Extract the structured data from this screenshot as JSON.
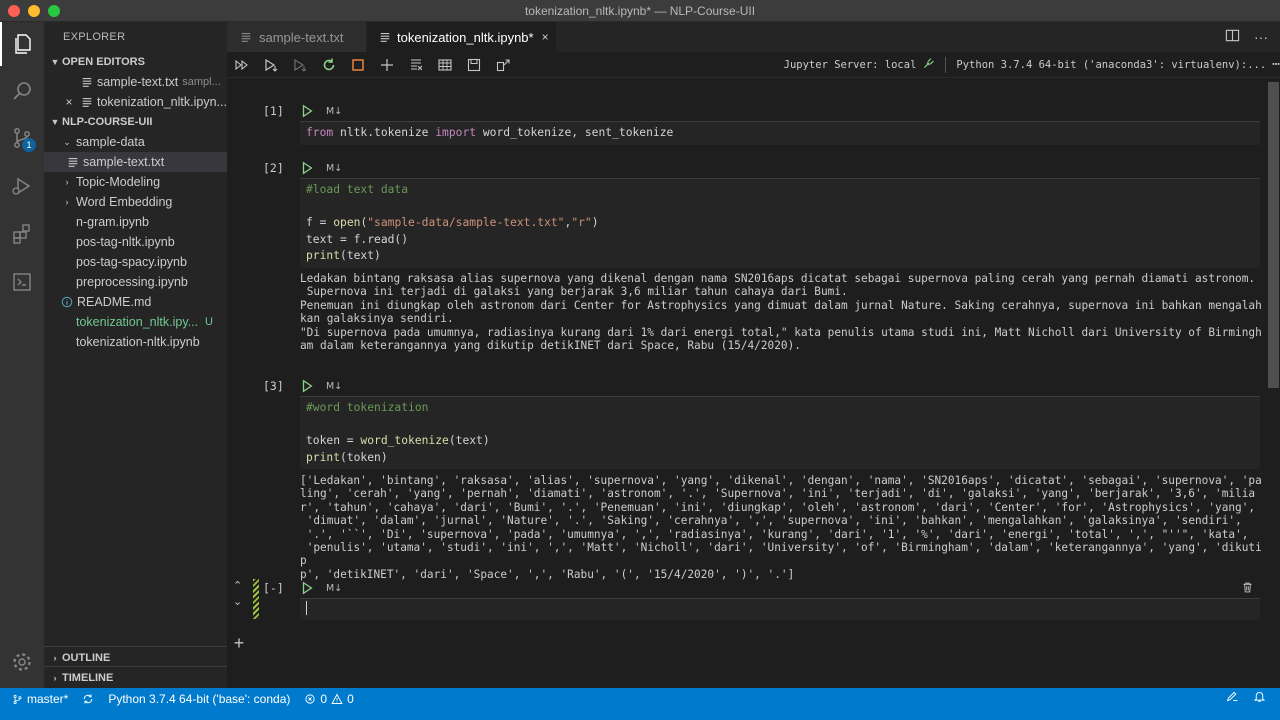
{
  "window": {
    "title": "tokenization_nltk.ipynb* — NLP-Course-UII"
  },
  "activity_bar": {
    "scm_badge": "1"
  },
  "sidebar": {
    "title": "EXPLORER",
    "open_editors": {
      "label": "OPEN EDITORS",
      "items": [
        {
          "name": "sample-text.txt",
          "detail": "sampl..."
        },
        {
          "name": "tokenization_nltk.ipyn..."
        }
      ]
    },
    "workspace": {
      "label": "NLP-COURSE-UII",
      "folder_sample_data": "sample-data",
      "file_sample_text": "sample-text.txt",
      "folder_topic_modeling": "Topic-Modeling",
      "folder_word_embedding": "Word Embedding",
      "file_ngram": "n-gram.ipynb",
      "file_pos_nltk": "pos-tag-nltk.ipynb",
      "file_pos_spacy": "pos-tag-spacy.ipynb",
      "file_preprocessing": "preprocessing.ipynb",
      "file_readme": "README.md",
      "file_tokenization_underscore": "tokenization_nltk.ipy...",
      "file_tokenization_underscore_status": "U",
      "file_tokenization_dash": "tokenization-nltk.ipynb"
    },
    "outline_label": "OUTLINE",
    "timeline_label": "TIMELINE"
  },
  "tabs": [
    {
      "label": "sample-text.txt"
    },
    {
      "label": "tokenization_nltk.ipynb*",
      "close": "×"
    }
  ],
  "tab_more": "···",
  "toolbar": {
    "jupyter_server": "Jupyter Server: local",
    "python_kernel": "Python 3.7.4 64-bit ('anaconda3': virtualenv):..."
  },
  "cells": [
    {
      "exec": "[1]",
      "md": "M↓",
      "code_import_kw_from": "from",
      "code_import_mod": " nltk.tokenize ",
      "code_import_kw_import": "import",
      "code_import_names": " word_tokenize, sent_tokenize"
    },
    {
      "exec": "[2]",
      "md": "M↓",
      "comment": "#load text data",
      "l2a": "f = ",
      "l2fn": "open",
      "l2b": "(",
      "l2s1": "\"sample-data/sample-text.txt\"",
      "l2c": ",",
      "l2s2": "\"r\"",
      "l2d": ")",
      "l3": "text = f.read()",
      "l4fn": "print",
      "l4": "(text)",
      "output": "Ledakan bintang raksasa alias supernova yang dikenal dengan nama SN2016aps dicatat sebagai supernova paling cerah yang pernah diamati astronom.\n Supernova ini terjadi di galaksi yang berjarak 3,6 miliar tahun cahaya dari Bumi.\nPenemuan ini diungkap oleh astronom dari Center for Astrophysics yang dimuat dalam jurnal Nature. Saking cerahnya, supernova ini bahkan mengalah\nkan galaksinya sendiri.\n\"Di supernova pada umumnya, radiasinya kurang dari 1% dari energi total,\" kata penulis utama studi ini, Matt Nicholl dari University of Birmingh\nam dalam keterangannya yang dikutip detikINET dari Space, Rabu (15/4/2020)."
    },
    {
      "exec": "[3]",
      "md": "M↓",
      "comment": "#word tokenization",
      "l2a": "token = ",
      "l2fn": "word_tokenize",
      "l2b": "(text)",
      "l3fn": "print",
      "l3": "(token)",
      "output": "['Ledakan', 'bintang', 'raksasa', 'alias', 'supernova', 'yang', 'dikenal', 'dengan', 'nama', 'SN2016aps', 'dicatat', 'sebagai', 'supernova', 'pa\nling', 'cerah', 'yang', 'pernah', 'diamati', 'astronom', '.', 'Supernova', 'ini', 'terjadi', 'di', 'galaksi', 'yang', 'berjarak', '3,6', 'milia\nr', 'tahun', 'cahaya', 'dari', 'Bumi', '.', 'Penemuan', 'ini', 'diungkap', 'oleh', 'astronom', 'dari', 'Center', 'for', 'Astrophysics', 'yang',\n 'dimuat', 'dalam', 'jurnal', 'Nature', '.', 'Saking', 'cerahnya', ',', 'supernova', 'ini', 'bahkan', 'mengalahkan', 'galaksinya', 'sendiri',\n '.', '``', 'Di', 'supernova', 'pada', 'umumnya', ',', 'radiasinya', 'kurang', 'dari', '1', '%', 'dari', 'energi', 'total', ',', \"''\", 'kata',\n 'penulis', 'utama', 'studi', 'ini', ',', 'Matt', 'Nicholl', 'dari', 'University', 'of', 'Birmingham', 'dalam', 'keterangannya', 'yang', 'dikutip\np', 'detikINET', 'dari', 'Space', ',', 'Rabu', '(', '15/4/2020', ')', '.']"
    },
    {
      "exec": "[-]",
      "md": "M↓"
    }
  ],
  "add_cell": "+",
  "statusbar": {
    "branch": "master*",
    "python": "Python 3.7.4 64-bit ('base': conda)",
    "errors": "0",
    "warnings": "0"
  }
}
